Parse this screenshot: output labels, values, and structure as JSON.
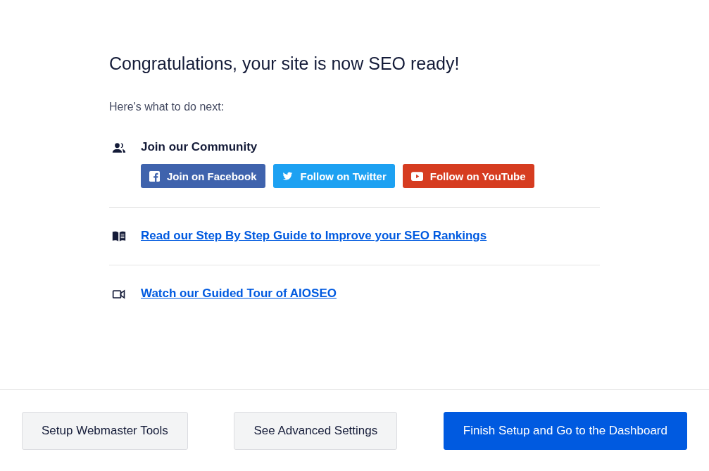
{
  "heading": "Congratulations, your site is now SEO ready!",
  "intro": "Here's what to do next:",
  "sections": [
    {
      "kind": "community",
      "title": "Join our Community",
      "buttons": [
        {
          "kind": "facebook",
          "label": "Join on Facebook",
          "color": "#3f63ad"
        },
        {
          "kind": "twitter",
          "label": "Follow on Twitter",
          "color": "#1da1f2"
        },
        {
          "kind": "youtube",
          "label": "Follow on YouTube",
          "color": "#d63c20"
        }
      ]
    },
    {
      "kind": "guide",
      "link": "Read our Step By Step Guide to Improve your SEO Rankings"
    },
    {
      "kind": "video",
      "link": "Watch our Guided Tour of AIOSEO"
    }
  ],
  "footer": [
    {
      "kind": "secondary",
      "label": "Setup Webmaster Tools"
    },
    {
      "kind": "secondary",
      "label": "See Advanced Settings"
    },
    {
      "kind": "primary",
      "label": "Finish Setup and Go to the Dashboard"
    }
  ]
}
